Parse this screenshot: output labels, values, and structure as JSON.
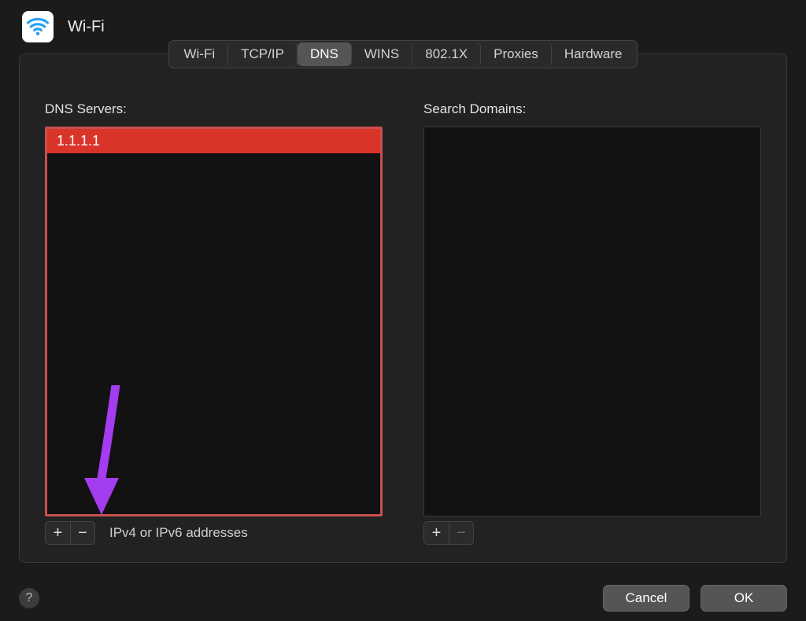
{
  "header": {
    "title": "Wi-Fi"
  },
  "tabs": {
    "items": [
      "Wi-Fi",
      "TCP/IP",
      "DNS",
      "WINS",
      "802.1X",
      "Proxies",
      "Hardware"
    ],
    "selected_index": 2
  },
  "dns": {
    "label": "DNS Servers:",
    "rows": [
      "1.1.1.1"
    ],
    "selected_index": 0,
    "hint": "IPv4 or IPv6 addresses",
    "add_icon": "plus-icon",
    "remove_icon": "minus-icon"
  },
  "search_domains": {
    "label": "Search Domains:",
    "rows": []
  },
  "buttons": {
    "cancel": "Cancel",
    "ok": "OK"
  },
  "annotation": {
    "arrow_color": "#a43cf0"
  }
}
